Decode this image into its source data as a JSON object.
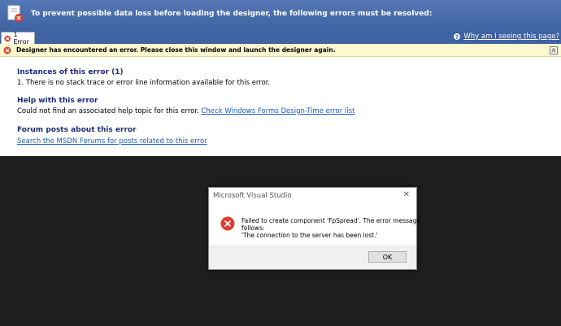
{
  "header": {
    "title": "To prevent possible data loss before loading the designer, the following errors must be resolved:"
  },
  "tabs": [
    {
      "label": "1 Error"
    }
  ],
  "help_link": "Why am I seeing this page?",
  "error_bar": {
    "text": "Designer has encountered an error. Please close this window and launch the designer again."
  },
  "instances": {
    "title": "Instances of this error (1)",
    "items": [
      "1.   There is no stack trace or error line information available for this error."
    ]
  },
  "help": {
    "title": "Help with this error",
    "text": "Could not find an associated help topic for this error.",
    "link": "Check Windows Forms Design-Time error list"
  },
  "forum": {
    "title": "Forum posts about this error",
    "link": "Search the MSDN Forums for posts related to this error"
  },
  "dialog": {
    "title": "Microsoft Visual Studio",
    "close": "✕",
    "message_lines": [
      "Failed to create component 'FpSpread'.  The error message",
      "follows:",
      "'The connection to the server has been lost.'"
    ],
    "ok_label": "OK"
  },
  "colors": {
    "header_bg": "#4a6eae",
    "error_red": "#e23b2e",
    "link": "#1a5bc4",
    "section_title": "#1b2c7a"
  }
}
